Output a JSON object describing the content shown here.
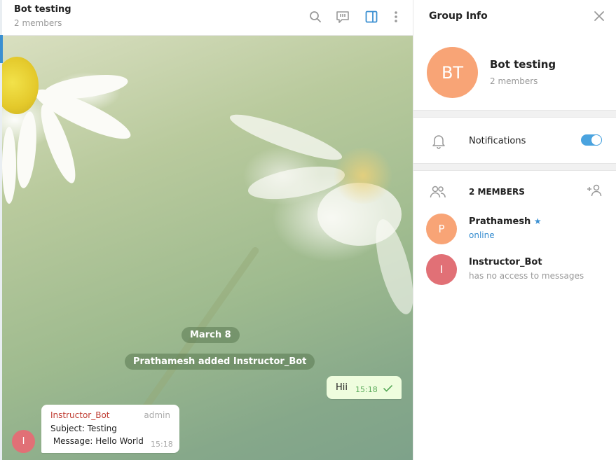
{
  "header": {
    "title": "Bot testing",
    "subtitle": "2 members",
    "icons": [
      "search-icon",
      "discussion-icon",
      "sidebar-toggle-icon",
      "more-vertical-icon"
    ]
  },
  "chat": {
    "date_label": "March 8",
    "service_message": "Prathamesh added Instructor_Bot",
    "outgoing": {
      "text": "Hii",
      "time": "15:18",
      "status_icon": "double-check-icon"
    },
    "incoming": {
      "sender": "Instructor_Bot",
      "badge": "admin",
      "line1": "Subject: Testing",
      "line2": " Message: Hello World",
      "time": "15:18",
      "avatar_letter": "I"
    }
  },
  "panel": {
    "title": "Group Info",
    "avatar_initials": "BT",
    "group_name": "Bot testing",
    "member_count": "2 members",
    "notifications_label": "Notifications",
    "notifications_on": true,
    "members_header": "2 MEMBERS",
    "members": [
      {
        "initial": "P",
        "name": "Prathamesh",
        "status": "online",
        "owner_star": true,
        "color": "#f8a476",
        "status_color": "#3a8fd1"
      },
      {
        "initial": "I",
        "name": "Instructor_Bot",
        "status": "has no access to messages",
        "owner_star": false,
        "color": "#e17076",
        "status_color": "#999999"
      }
    ]
  },
  "colors": {
    "accent": "#4aa3df",
    "outgoing_bubble": "#effdde",
    "sender_name": "#c03d33"
  }
}
